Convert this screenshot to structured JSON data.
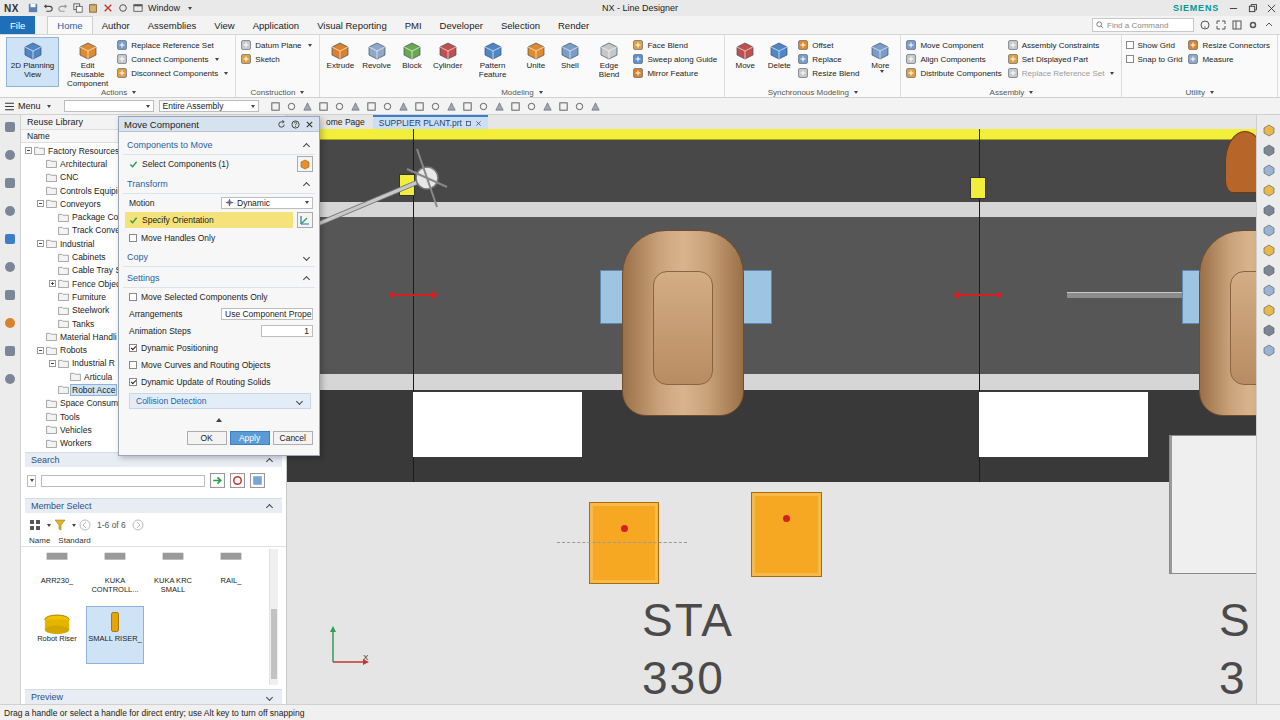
{
  "titlebar": {
    "app": "NX",
    "window_menu": "Window",
    "title": "NX - Line Designer",
    "brand": "SIEMENS"
  },
  "ribbon_tabs": [
    {
      "label": "File",
      "kind": "file",
      "selected": false
    },
    {
      "label": "Home",
      "kind": "tab",
      "selected": true
    },
    {
      "label": "Author",
      "kind": "tab",
      "selected": false
    },
    {
      "label": "Assemblies",
      "kind": "tab",
      "selected": false
    },
    {
      "label": "View",
      "kind": "tab",
      "selected": false
    },
    {
      "label": "Application",
      "kind": "tab",
      "selected": false
    },
    {
      "label": "Visual Reporting",
      "kind": "tab",
      "selected": false
    },
    {
      "label": "PMI",
      "kind": "tab",
      "selected": false
    },
    {
      "label": "Developer",
      "kind": "tab",
      "selected": false
    },
    {
      "label": "Selection",
      "kind": "tab",
      "selected": false
    },
    {
      "label": "Render",
      "kind": "tab",
      "selected": false
    }
  ],
  "command_search": {
    "placeholder": "Find a Command"
  },
  "ribbon_groups": [
    {
      "label": "Actions",
      "columns": [
        [
          {
            "label": "2D Planning View",
            "kind": "command",
            "has_menu": false,
            "active": true,
            "disabled": false
          }
        ],
        [
          {
            "label": "Edit Reusable Component",
            "kind": "command",
            "has_menu": false,
            "active": false,
            "disabled": false
          }
        ],
        [
          {
            "label": "Replace Reference Set",
            "kind": "command",
            "has_menu": false,
            "active": false,
            "disabled": false
          },
          {
            "label": "Connect Components",
            "kind": "command",
            "has_menu": true,
            "active": false,
            "disabled": false
          },
          {
            "label": "Disconnect Components",
            "kind": "command",
            "has_menu": true,
            "active": false,
            "disabled": false
          }
        ]
      ]
    },
    {
      "label": "Construction",
      "columns": [
        [
          {
            "label": "Datum Plane",
            "kind": "command",
            "has_menu": true,
            "active": false,
            "disabled": false
          },
          {
            "label": "Sketch",
            "kind": "command",
            "has_menu": false,
            "active": false,
            "disabled": false
          }
        ]
      ]
    },
    {
      "label": "Modeling",
      "columns": [
        [
          {
            "label": "Extrude",
            "kind": "command",
            "has_menu": false,
            "active": false,
            "disabled": false
          }
        ],
        [
          {
            "label": "Revolve",
            "kind": "command",
            "has_menu": false,
            "active": false,
            "disabled": false
          }
        ],
        [
          {
            "label": "Block",
            "kind": "command",
            "has_menu": false,
            "active": false,
            "disabled": false
          }
        ],
        [
          {
            "label": "Cylinder",
            "kind": "command",
            "has_menu": false,
            "active": false,
            "disabled": false
          }
        ],
        [
          {
            "label": "Pattern Feature",
            "kind": "command",
            "has_menu": false,
            "active": false,
            "disabled": false
          }
        ],
        [
          {
            "label": "Unite",
            "kind": "command",
            "has_menu": false,
            "active": false,
            "disabled": false
          }
        ],
        [
          {
            "label": "Shell",
            "kind": "command",
            "has_menu": false,
            "active": false,
            "disabled": false
          }
        ],
        [
          {
            "label": "Edge Blend",
            "kind": "command",
            "has_menu": false,
            "active": false,
            "disabled": false
          }
        ],
        [
          {
            "label": "Face Blend",
            "kind": "command",
            "has_menu": false,
            "active": false,
            "disabled": false
          },
          {
            "label": "Sweep along Guide",
            "kind": "command",
            "has_menu": false,
            "active": false,
            "disabled": false
          },
          {
            "label": "Mirror Feature",
            "kind": "command",
            "has_menu": false,
            "active": false,
            "disabled": false
          }
        ]
      ]
    },
    {
      "label": "Synchronous Modeling",
      "columns": [
        [
          {
            "label": "Move",
            "kind": "command",
            "has_menu": false,
            "active": false,
            "disabled": false
          }
        ],
        [
          {
            "label": "Delete",
            "kind": "command",
            "has_menu": false,
            "active": false,
            "disabled": false
          }
        ],
        [
          {
            "label": "Offset",
            "kind": "command",
            "has_menu": false,
            "active": false,
            "disabled": false
          },
          {
            "label": "Replace",
            "kind": "command",
            "has_menu": false,
            "active": false,
            "disabled": false
          },
          {
            "label": "Resize Blend",
            "kind": "command",
            "has_menu": false,
            "active": false,
            "disabled": false
          }
        ],
        [
          {
            "label": "More",
            "kind": "command",
            "has_menu": true,
            "active": false,
            "disabled": false
          }
        ]
      ]
    },
    {
      "label": "Assembly",
      "columns": [
        [
          {
            "label": "Move Component",
            "kind": "command",
            "has_menu": false,
            "active": false,
            "disabled": false
          },
          {
            "label": "Align Components",
            "kind": "command",
            "has_menu": false,
            "active": false,
            "disabled": false
          },
          {
            "label": "Distribute Components",
            "kind": "command",
            "has_menu": false,
            "active": false,
            "disabled": false
          }
        ],
        [
          {
            "label": "Assembly Constraints",
            "kind": "command",
            "has_menu": false,
            "active": false,
            "disabled": false
          },
          {
            "label": "Set Displayed Part",
            "kind": "command",
            "has_menu": false,
            "active": false,
            "disabled": false
          },
          {
            "label": "Replace Reference Set",
            "kind": "command",
            "has_menu": true,
            "active": false,
            "disabled": true
          }
        ]
      ]
    },
    {
      "label": "Utility",
      "columns": [
        [
          {
            "label": "Show Grid",
            "kind": "checkbox",
            "checked": false,
            "has_menu": false,
            "active": false,
            "disabled": false
          },
          {
            "label": "Snap to Grid",
            "kind": "checkbox",
            "checked": false,
            "has_menu": false,
            "active": false,
            "disabled": false
          }
        ],
        [
          {
            "label": "Resize Connectors",
            "kind": "command",
            "has_menu": false,
            "active": false,
            "disabled": false
          },
          {
            "label": "Measure",
            "kind": "command",
            "has_menu": false,
            "active": false,
            "disabled": false
          }
        ]
      ]
    }
  ],
  "toolbar": {
    "menu": "Menu",
    "filter_value": "",
    "scope_value": "Entire Assembly"
  },
  "reuse_library": {
    "title": "Reuse Library",
    "column": "Name",
    "tree": [
      {
        "label": "Factory Resources",
        "depth": 0,
        "expander": "expanded",
        "selected": false
      },
      {
        "label": "Architectural",
        "depth": 1,
        "expander": "none",
        "selected": false
      },
      {
        "label": "CNC",
        "depth": 1,
        "expander": "none",
        "selected": false
      },
      {
        "label": "Controls Equipi",
        "depth": 1,
        "expander": "none",
        "selected": false
      },
      {
        "label": "Conveyors",
        "depth": 1,
        "expander": "expanded",
        "selected": false
      },
      {
        "label": "Package Co",
        "depth": 2,
        "expander": "none",
        "selected": false
      },
      {
        "label": "Track Conve",
        "depth": 2,
        "expander": "none",
        "selected": false
      },
      {
        "label": "Industrial",
        "depth": 1,
        "expander": "expanded",
        "selected": false
      },
      {
        "label": "Cabinets",
        "depth": 2,
        "expander": "none",
        "selected": false
      },
      {
        "label": "Cable Tray S",
        "depth": 2,
        "expander": "none",
        "selected": false
      },
      {
        "label": "Fence Objec",
        "depth": 2,
        "expander": "collapsed",
        "selected": false
      },
      {
        "label": "Furniture",
        "depth": 2,
        "expander": "none",
        "selected": false
      },
      {
        "label": "Steelwork",
        "depth": 2,
        "expander": "none",
        "selected": false
      },
      {
        "label": "Tanks",
        "depth": 2,
        "expander": "none",
        "selected": false
      },
      {
        "label": "Material Handli",
        "depth": 1,
        "expander": "none",
        "selected": false
      },
      {
        "label": "Robots",
        "depth": 1,
        "expander": "expanded",
        "selected": false
      },
      {
        "label": "Industrial R",
        "depth": 2,
        "expander": "expanded",
        "selected": false
      },
      {
        "label": "Articula",
        "depth": 3,
        "expander": "none",
        "selected": false
      },
      {
        "label": "Robot Acce",
        "depth": 2,
        "expander": "none",
        "selected": true
      },
      {
        "label": "Space Consum",
        "depth": 1,
        "expander": "none",
        "selected": false
      },
      {
        "label": "Tools",
        "depth": 1,
        "expander": "none",
        "selected": false
      },
      {
        "label": "Vehicles",
        "depth": 1,
        "expander": "none",
        "selected": false
      },
      {
        "label": "Workers",
        "depth": 1,
        "expander": "none",
        "selected": false
      }
    ],
    "search": {
      "label": "Search",
      "value": ""
    },
    "member_select": {
      "label": "Member Select",
      "count": "1-6 of 6",
      "columns": [
        "Name",
        "Standard"
      ],
      "items": [
        {
          "name": "ARR230_",
          "selected": false
        },
        {
          "name": "KUKA CONTROLL...",
          "selected": false
        },
        {
          "name": "KUKA KRC SMALL",
          "selected": false
        },
        {
          "name": "RAIL_",
          "selected": false
        },
        {
          "name": "Robot Riser",
          "selected": false
        },
        {
          "name": "SMALL RISER_",
          "selected": true
        }
      ]
    },
    "preview": {
      "label": "Preview"
    }
  },
  "dialog": {
    "title": "Move Component",
    "components_to_move": {
      "label": "Components to Move",
      "expanded": true,
      "select_label": "Select Components (1)",
      "done": true
    },
    "transform": {
      "label": "Transform",
      "expanded": true,
      "motion_label": "Motion",
      "motion_value": "Dynamic",
      "orientation_label": "Specify Orientation",
      "orientation_done": true,
      "move_handles_only": {
        "label": "Move Handles Only",
        "checked": false
      }
    },
    "copy": {
      "label": "Copy",
      "expanded": false
    },
    "settings": {
      "label": "Settings",
      "expanded": true,
      "rows": [
        {
          "kind": "checkbox",
          "label": "Move Selected Components Only",
          "checked": false
        },
        {
          "kind": "select",
          "label": "Arrangements",
          "value": "Use Component Prope"
        },
        {
          "kind": "number",
          "label": "Animation Steps",
          "value": "1"
        },
        {
          "kind": "checkbox",
          "label": "Dynamic Positioning",
          "checked": true
        },
        {
          "kind": "checkbox",
          "label": "Move Curves and Routing Objects",
          "checked": false
        },
        {
          "kind": "checkbox",
          "label": "Dynamic Update of Routing Solids",
          "checked": true
        }
      ]
    },
    "collision": {
      "label": "Collision Detection",
      "expanded": false
    },
    "buttons": [
      {
        "label": "OK",
        "highlighted": false
      },
      {
        "label": "Apply",
        "highlighted": true
      },
      {
        "label": "Cancel",
        "highlighted": false
      }
    ]
  },
  "graphics_tabs": [
    {
      "label": "ome Page",
      "selected": false
    },
    {
      "label": "SUPPLIER PLANT.prt",
      "selected": true
    }
  ],
  "canvas": {
    "stations": [
      {
        "name": "STA",
        "number": "330"
      },
      {
        "name": "S",
        "number": "3"
      }
    ],
    "triad_label": "X"
  },
  "status_bar": "Drag a handle or select a handle for direct entry; use Alt key to turn off snapping"
}
